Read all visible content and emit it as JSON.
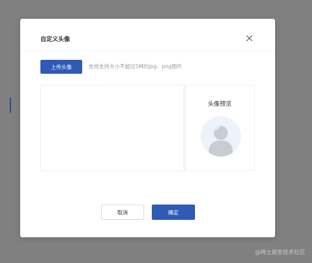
{
  "dialog": {
    "title": "自定义头像",
    "upload_label": "上传头像",
    "hint": "支持支持大小不超过5M的jpg、png图片",
    "preview_title": "头像预览",
    "cancel_label": "取消",
    "ok_label": "确定"
  },
  "watermark": "@稀土掘金技术社区",
  "colors": {
    "primary": "#2f5bb6",
    "backdrop": "#808080",
    "avatar_bg": "#eef2fb",
    "avatar_figure": "#c9ccd2"
  },
  "icons": {
    "close": "close-icon",
    "avatar": "default-avatar-icon"
  }
}
